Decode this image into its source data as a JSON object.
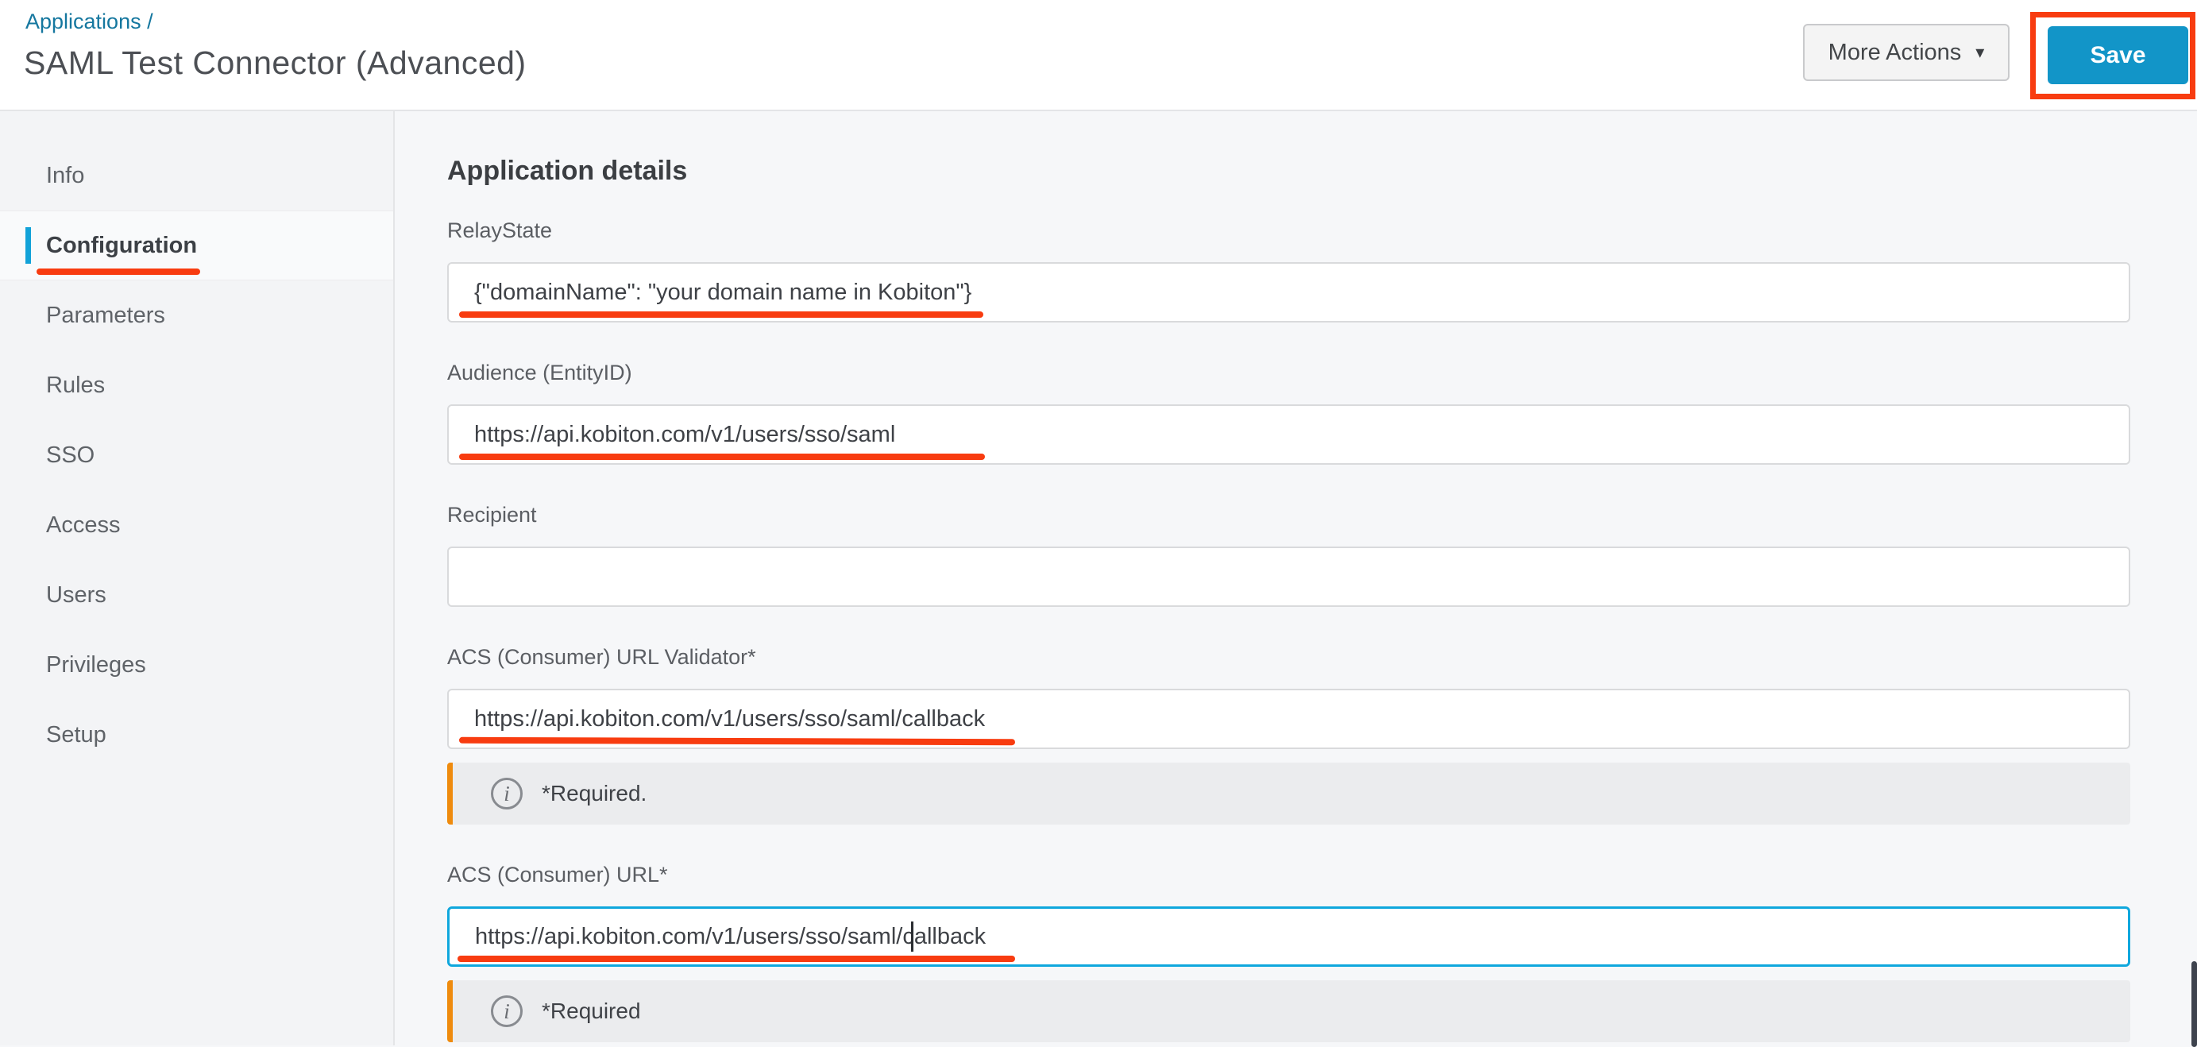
{
  "colors": {
    "accent_blue": "#0fa7dd",
    "breadcrumb_link": "#15779f",
    "save_button_bg": "#1295c8",
    "annotation_red": "#f83c10",
    "note_border_orange": "#ef8b0e"
  },
  "header": {
    "breadcrumb": "Applications /",
    "title": "SAML Test Connector (Advanced)",
    "more_actions_label": "More Actions",
    "save_label": "Save"
  },
  "icons": {
    "caret_down": "▾",
    "info": "i"
  },
  "sidebar": {
    "items": [
      {
        "label": "Info",
        "active": false
      },
      {
        "label": "Configuration",
        "active": true
      },
      {
        "label": "Parameters",
        "active": false
      },
      {
        "label": "Rules",
        "active": false
      },
      {
        "label": "SSO",
        "active": false
      },
      {
        "label": "Access",
        "active": false
      },
      {
        "label": "Users",
        "active": false
      },
      {
        "label": "Privileges",
        "active": false
      },
      {
        "label": "Setup",
        "active": false
      }
    ]
  },
  "main": {
    "heading": "Application details",
    "fields": {
      "relay_state": {
        "label": "RelayState",
        "value": "{\"domainName\": \"your domain name in Kobiton\"}"
      },
      "audience": {
        "label": "Audience (EntityID)",
        "value": "https://api.kobiton.com/v1/users/sso/saml"
      },
      "recipient": {
        "label": "Recipient",
        "value": ""
      },
      "acs_url_validator": {
        "label": "ACS (Consumer) URL Validator*",
        "value": "https://api.kobiton.com/v1/users/sso/saml/callback",
        "note": "*Required."
      },
      "acs_url": {
        "label": "ACS (Consumer) URL*",
        "value": "https://api.kobiton.com/v1/users/sso/saml/callback",
        "note": "*Required"
      }
    }
  }
}
